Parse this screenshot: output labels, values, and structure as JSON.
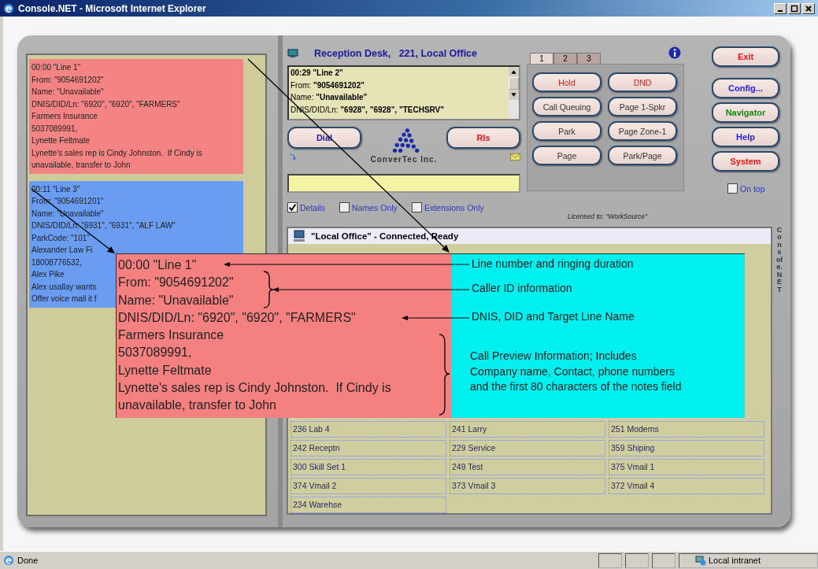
{
  "window": {
    "title": "Console.NET - Microsoft Internet Explorer"
  },
  "call_cards": [
    {
      "color": "#f48484",
      "lines": [
        "00:00 \"Line 1\"",
        "From: \"9054691202\"",
        "Name: \"Unavailable\"",
        "DNIS/DID/Ln: \"6920\", \"6920\", \"FARMERS\"",
        "Farmers Insurance",
        "5037089991,",
        "Lynette Feltmate",
        "Lynette's sales rep is Cindy Johnston.  If Cindy is unavailable, transfer to John"
      ]
    },
    {
      "color": "#6a9cf2",
      "lines": [
        "00:11 \"Line 3\"",
        "From: \"9054691201\"",
        "Name: \"Unavailable\"",
        "DNIS/DID/Ln: \"6931\", \"6931\", \"ALF LAW\"",
        "ParkCode: \"101\"",
        "Alexander Law Fi",
        "18008776532,",
        "Alex Pike",
        "Alex usallay wants",
        "Offer voice mail it f"
      ]
    }
  ],
  "station": {
    "title": "Reception Desk,   221, Local Office"
  },
  "call_info": [
    {
      "value": "00:29 \"Line 2\""
    },
    {
      "label": "From:",
      "value": "\"9054691202\""
    },
    {
      "label": "Name:",
      "value": "\"Unavailable\""
    },
    {
      "label": "DNIS/DID/Ln:",
      "value": "\"6928\", \"6928\", \"TECHSRV\""
    }
  ],
  "call_buttons": [
    {
      "label": "Dial",
      "color": "#2020a0"
    },
    {
      "label": "Rls",
      "color": "#ee1111"
    }
  ],
  "logo": {
    "text": "ConverTec Inc."
  },
  "filters": [
    {
      "label": "Details",
      "checked": true
    },
    {
      "label": "Names Only",
      "checked": false
    },
    {
      "label": "Extensions Only",
      "checked": false
    }
  ],
  "tabs": [
    {
      "label": "1",
      "selected": true
    },
    {
      "label": "2",
      "selected": false
    },
    {
      "label": "3",
      "selected": false
    }
  ],
  "feature_buttons": [
    {
      "label": "Hold",
      "color": "#ee1111"
    },
    {
      "label": "DND",
      "color": "#ee1111"
    },
    {
      "label": "Call Queuing",
      "color": "#333333"
    },
    {
      "label": "Page 1-Spkr",
      "color": "#333333"
    },
    {
      "label": "Park",
      "color": "#333333"
    },
    {
      "label": "Page Zone-1",
      "color": "#333333"
    },
    {
      "label": "Page",
      "color": "#333333"
    },
    {
      "label": "Park/Page",
      "color": "#333333"
    }
  ],
  "side_buttons": [
    {
      "label": "Exit",
      "color": "#ee1111"
    },
    {
      "label": "Config...",
      "color": "#2222dd"
    },
    {
      "label": "Navigator",
      "color": "#118811"
    },
    {
      "label": "Help",
      "color": "#2222dd"
    },
    {
      "label": "System",
      "color": "#ee1111"
    }
  ],
  "on_top": {
    "label": "On top",
    "checked": false
  },
  "license": "Licensed to: \"WorkSource\"",
  "directory": {
    "status": "\"Local Office\" - Connected, Ready",
    "extensions": [
      [
        "236 Lab 4",
        "241 Larry",
        "251 Modems"
      ],
      [
        "242 Receptn",
        "229 Service",
        "359 Shiping"
      ],
      [
        "300 Skill Set 1",
        "249 Test",
        "375 Vmail 1"
      ],
      [
        "374 Vmail 2",
        "373 Vmail 3",
        "372 Vmail 4"
      ],
      [
        "234 Warehse"
      ]
    ]
  },
  "side_label": "Console.NET",
  "callout": {
    "preview_lines": [
      "00:00 \"Line 1\"",
      "From: \"9054691202\"",
      "Name: \"Unavailable\"",
      "DNIS/DID/Ln: \"6920\", \"6920\", \"FARMERS\"",
      "Farmers Insurance",
      "5037089991,",
      "Lynette Feltmate",
      "Lynette's sales rep is Cindy Johnston.  If Cindy is unavailable, transfer to John"
    ],
    "notes": [
      "Line number and ringing duration",
      "Caller ID information",
      "DNIS, DID and Target Line Name",
      "Call Preview Information; Includes\nCompany name, Contact, phone numbers\nand the first 80 characters of the notes field"
    ]
  },
  "status_bar": {
    "text": "Done",
    "zone": "Local intranet"
  }
}
